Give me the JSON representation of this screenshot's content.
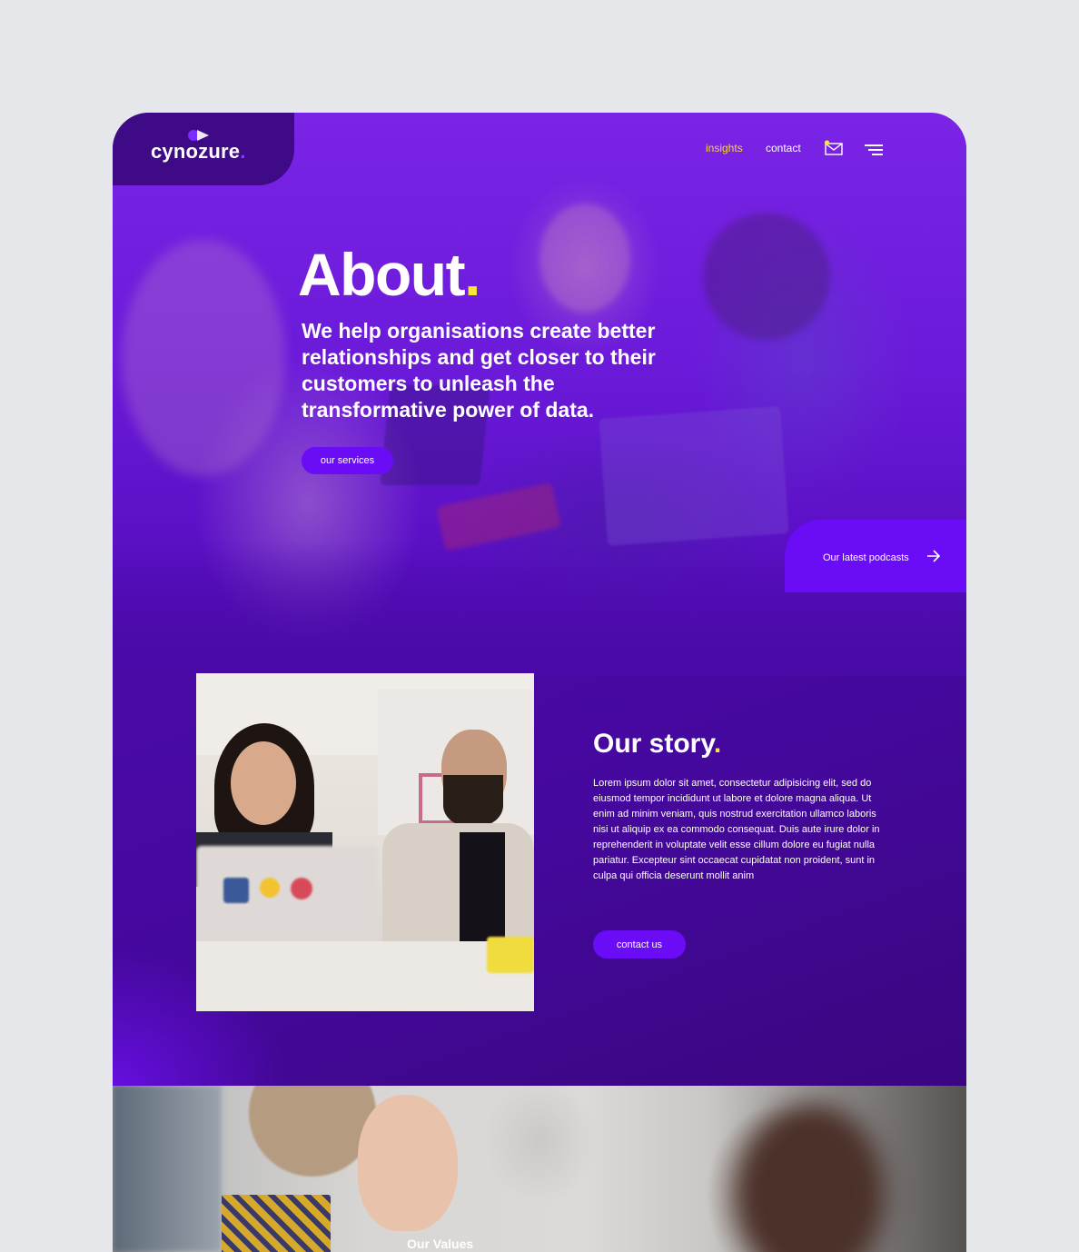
{
  "brand": {
    "name": "cynozure",
    "dot": ".",
    "accent": "#6a0cf5",
    "highlight": "#f5e637"
  },
  "nav": {
    "insights": "insights",
    "contact": "contact",
    "mail_icon": "mail-icon",
    "menu_icon": "menu-icon"
  },
  "hero": {
    "title": "About",
    "title_dot": ".",
    "lead": "We help organisations create better relationships and get closer to their customers to unleash the transformative power of data.",
    "cta": "our services",
    "podcasts_label": "Our latest podcasts",
    "podcasts_icon": "arrow-right-icon"
  },
  "story": {
    "title": "Our story",
    "title_dot": ".",
    "body": "Lorem ipsum dolor sit amet, consectetur adipisicing elit, sed do eiusmod tempor incididunt ut labore et dolore magna aliqua. Ut enim ad minim veniam, quis nostrud exercitation ullamco laboris nisi ut aliquip ex ea commodo consequat. Duis aute irure dolor in reprehenderit in voluptate velit esse cillum dolore eu fugiat nulla pariatur. Excepteur sint occaecat cupidatat non proident, sunt in culpa qui officia deserunt mollit anim",
    "cta": "contact us"
  },
  "values": {
    "title": "Our Values"
  }
}
